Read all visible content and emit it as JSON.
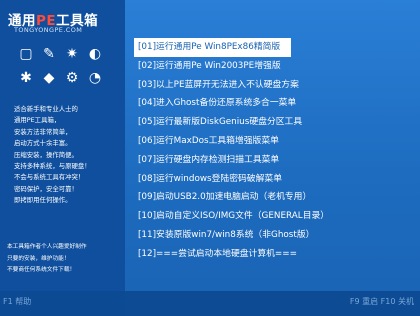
{
  "logo": {
    "title_prefix": "通用",
    "title_pe": "PE",
    "title_suffix": "工具箱",
    "url": "TONGYONGPE.COM"
  },
  "left_icons": [
    "▢",
    "✎",
    "✷",
    "◐",
    "✱",
    "◆",
    "⚙",
    "◔"
  ],
  "intro_lines": [
    "适合新手和专业人士的",
    "通用PE工具箱，",
    "安装方法非常简单，",
    "启动方式十余丰富。",
    "压缩安装，操作简便。",
    "支持多种系统，与原硬盘！",
    "不会与系统工具有冲突！",
    "密码保护，安全可靠！",
    "即拷即用任何操作。"
  ],
  "footer_lines": [
    "本工具箱作者个人兴趣爱好制作",
    "只要的安装，维护功能！",
    "不要商任何系统文件下载！"
  ],
  "bottom": {
    "left_hint": "F1 帮助",
    "right_hint": "F9 重启  F10 关机"
  },
  "menu_items": [
    "[01]运行通用Pe Win8PEx86精简版",
    "[02]运行通用Pe Win2003PE增强版",
    "[03]以上PE蓝屏开无法进入不认硬盘方案",
    "[04]进入Ghost备份还原系统多合一菜单",
    "[05]运行最新版DiskGenius硬盘分区工具",
    "[06]运行MaxDos工具箱增强版菜单",
    "[07]运行硬盘内存检测扫描工具菜单",
    "[08]运行windows登陆密码破解菜单",
    "[09]启动USB2.0加速电脑启动（老机专用）",
    "[10]启动自定义ISO/IMG文件（GENERAL目录）",
    "[11]安装原版win7/win8系统（非Ghost版）",
    "[12]===尝试启动本地硬盘计算机==="
  ],
  "selected_index": 0
}
